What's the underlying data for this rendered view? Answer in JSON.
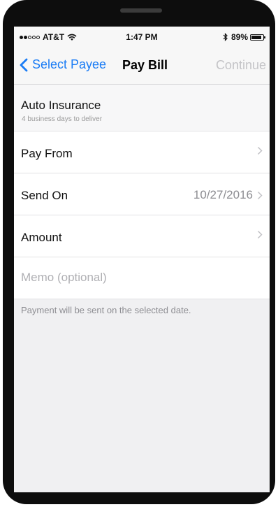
{
  "status_bar": {
    "carrier": "AT&T",
    "time": "1:47 PM",
    "battery_percent": "89%",
    "battery_level": 0.89
  },
  "nav": {
    "back_label": "Select Payee",
    "title": "Pay Bill",
    "continue_label": "Continue"
  },
  "payee": {
    "name": "Auto Insurance",
    "delivery_note": "4 business days to deliver"
  },
  "rows": {
    "pay_from": {
      "label": "Pay From",
      "value": ""
    },
    "send_on": {
      "label": "Send On",
      "value": "10/27/2016"
    },
    "amount": {
      "label": "Amount",
      "value": ""
    }
  },
  "memo": {
    "placeholder": "Memo (optional)",
    "value": ""
  },
  "footer_note": "Payment will be sent on the selected date.",
  "colors": {
    "accent": "#1a7cf5",
    "disabled": "#c4c4c7",
    "secondary_text": "#8e8e93"
  }
}
